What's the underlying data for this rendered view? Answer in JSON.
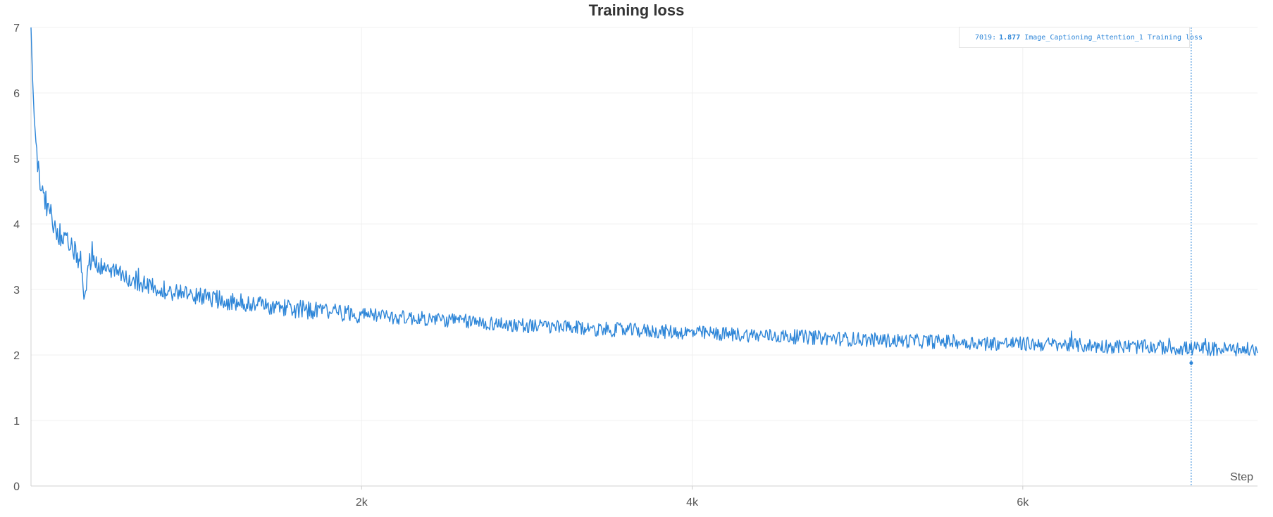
{
  "chart_data": {
    "type": "line",
    "title": "Training loss",
    "xlabel": "Step",
    "ylabel": "",
    "xlim": [
      0,
      7420
    ],
    "ylim": [
      0,
      7
    ],
    "x_ticks": [
      2000,
      4000,
      6000
    ],
    "x_tick_labels": [
      "2k",
      "4k",
      "6k"
    ],
    "y_ticks": [
      0,
      1,
      2,
      3,
      4,
      5,
      6,
      7
    ],
    "y_tick_labels": [
      "0",
      "1",
      "2",
      "3",
      "4",
      "5",
      "6",
      "7"
    ],
    "grid": true,
    "legend": "top-right",
    "series_color": "#2E86D8",
    "series": [
      {
        "name": "Image_Captioning_Attention_1 Training loss",
        "x": [
          0,
          10,
          20,
          40,
          60,
          80,
          100,
          130,
          160,
          200,
          250,
          300,
          320,
          350,
          400,
          450,
          500,
          600,
          700,
          800,
          900,
          1000,
          1200,
          1400,
          1600,
          1800,
          2000,
          2200,
          2400,
          2600,
          2800,
          3000,
          3200,
          3400,
          3600,
          3800,
          4000,
          4200,
          4400,
          4600,
          4800,
          5000,
          5200,
          5400,
          5600,
          5800,
          6000,
          6200,
          6400,
          6600,
          6800,
          7000,
          7200,
          7400
        ],
        "y": [
          7.0,
          6.2,
          5.6,
          4.9,
          4.6,
          4.4,
          4.25,
          4.05,
          3.9,
          3.75,
          3.6,
          3.45,
          2.85,
          3.45,
          3.38,
          3.32,
          3.27,
          3.15,
          3.05,
          3.0,
          2.95,
          2.9,
          2.82,
          2.76,
          2.7,
          2.66,
          2.62,
          2.58,
          2.55,
          2.52,
          2.48,
          2.45,
          2.42,
          2.4,
          2.38,
          2.36,
          2.34,
          2.32,
          2.3,
          2.28,
          2.26,
          2.24,
          2.22,
          2.21,
          2.2,
          2.18,
          2.17,
          2.16,
          2.14,
          2.13,
          2.12,
          2.1,
          2.09,
          2.08
        ]
      }
    ],
    "hover": {
      "step": "7019:",
      "value": "1.877",
      "label": "Image_Captioning_Attention_1 Training loss",
      "x": 7019,
      "y": 1.877
    }
  }
}
